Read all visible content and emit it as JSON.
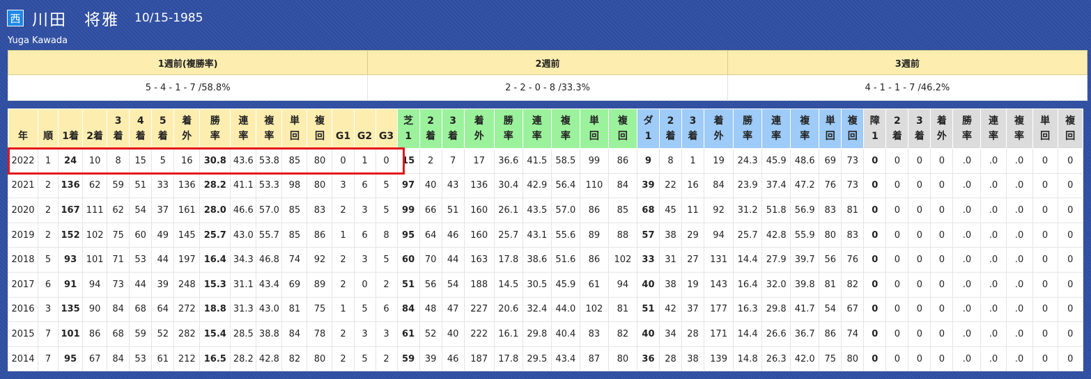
{
  "header": {
    "region_badge": "西",
    "name": "川田　将雅",
    "birthdate": "10/15-1985",
    "romaji": "Yuga Kawada"
  },
  "weeks": [
    {
      "label": "1週前(複勝率)",
      "value": "5 - 4 - 1 - 7 /58.8%"
    },
    {
      "label": "2週前",
      "value": "2 - 2 - 0 - 8 /33.3%"
    },
    {
      "label": "3週前",
      "value": "4 - 1 - 1 - 7 /46.2%"
    }
  ],
  "columns": [
    {
      "l1": "",
      "l2": "年",
      "g": "y"
    },
    {
      "l1": "",
      "l2": "順",
      "g": "y"
    },
    {
      "l1": "",
      "l2": "1着",
      "g": "y"
    },
    {
      "l1": "",
      "l2": "2着",
      "g": "y"
    },
    {
      "l1": "3",
      "l2": "着",
      "g": "y"
    },
    {
      "l1": "4",
      "l2": "着",
      "g": "y"
    },
    {
      "l1": "5",
      "l2": "着",
      "g": "y"
    },
    {
      "l1": "着",
      "l2": "外",
      "g": "y"
    },
    {
      "l1": "勝",
      "l2": "率",
      "g": "y"
    },
    {
      "l1": "連",
      "l2": "率",
      "g": "y"
    },
    {
      "l1": "複",
      "l2": "率",
      "g": "y"
    },
    {
      "l1": "単",
      "l2": "回",
      "g": "y"
    },
    {
      "l1": "複",
      "l2": "回",
      "g": "y"
    },
    {
      "l1": "",
      "l2": "G1",
      "g": "y"
    },
    {
      "l1": "",
      "l2": "G2",
      "g": "y"
    },
    {
      "l1": "",
      "l2": "G3",
      "g": "y"
    },
    {
      "l1": "芝",
      "l2": "1",
      "g": "g"
    },
    {
      "l1": "2",
      "l2": "着",
      "g": "g"
    },
    {
      "l1": "3",
      "l2": "着",
      "g": "g"
    },
    {
      "l1": "着",
      "l2": "外",
      "g": "g"
    },
    {
      "l1": "勝",
      "l2": "率",
      "g": "g"
    },
    {
      "l1": "連",
      "l2": "率",
      "g": "g"
    },
    {
      "l1": "複",
      "l2": "率",
      "g": "g"
    },
    {
      "l1": "単",
      "l2": "回",
      "g": "g"
    },
    {
      "l1": "複",
      "l2": "回",
      "g": "g"
    },
    {
      "l1": "ダ",
      "l2": "1",
      "g": "b"
    },
    {
      "l1": "2",
      "l2": "着",
      "g": "b"
    },
    {
      "l1": "3",
      "l2": "着",
      "g": "b"
    },
    {
      "l1": "着",
      "l2": "外",
      "g": "b"
    },
    {
      "l1": "勝",
      "l2": "率",
      "g": "b"
    },
    {
      "l1": "連",
      "l2": "率",
      "g": "b"
    },
    {
      "l1": "複",
      "l2": "率",
      "g": "b"
    },
    {
      "l1": "単",
      "l2": "回",
      "g": "b"
    },
    {
      "l1": "複",
      "l2": "回",
      "g": "b"
    },
    {
      "l1": "障",
      "l2": "1",
      "g": "s"
    },
    {
      "l1": "2",
      "l2": "着",
      "g": "s"
    },
    {
      "l1": "3",
      "l2": "着",
      "g": "s"
    },
    {
      "l1": "着",
      "l2": "外",
      "g": "s"
    },
    {
      "l1": "勝",
      "l2": "率",
      "g": "s"
    },
    {
      "l1": "連",
      "l2": "率",
      "g": "s"
    },
    {
      "l1": "複",
      "l2": "率",
      "g": "s"
    },
    {
      "l1": "単",
      "l2": "回",
      "g": "s"
    },
    {
      "l1": "複",
      "l2": "回",
      "g": "s"
    }
  ],
  "rows": [
    [
      "2022",
      "1",
      "24",
      "10",
      "8",
      "15",
      "5",
      "16",
      "30.8",
      "43.6",
      "53.8",
      "85",
      "80",
      "0",
      "1",
      "0",
      "15",
      "2",
      "7",
      "17",
      "36.6",
      "41.5",
      "58.5",
      "99",
      "86",
      "9",
      "8",
      "1",
      "19",
      "24.3",
      "45.9",
      "48.6",
      "69",
      "73",
      "0",
      "0",
      "0",
      "0",
      ".0",
      ".0",
      ".0",
      "0",
      "0"
    ],
    [
      "2021",
      "2",
      "136",
      "62",
      "59",
      "51",
      "33",
      "136",
      "28.2",
      "41.1",
      "53.3",
      "98",
      "80",
      "3",
      "6",
      "5",
      "97",
      "40",
      "43",
      "136",
      "30.4",
      "42.9",
      "56.4",
      "110",
      "84",
      "39",
      "22",
      "16",
      "84",
      "23.9",
      "37.4",
      "47.2",
      "76",
      "73",
      "0",
      "0",
      "0",
      "0",
      ".0",
      ".0",
      ".0",
      "0",
      "0"
    ],
    [
      "2020",
      "2",
      "167",
      "111",
      "62",
      "54",
      "37",
      "161",
      "28.0",
      "46.6",
      "57.0",
      "85",
      "83",
      "2",
      "3",
      "5",
      "99",
      "66",
      "51",
      "160",
      "26.1",
      "43.5",
      "57.0",
      "86",
      "85",
      "68",
      "45",
      "11",
      "92",
      "31.2",
      "51.8",
      "56.9",
      "83",
      "81",
      "0",
      "0",
      "0",
      "0",
      ".0",
      ".0",
      ".0",
      "0",
      "0"
    ],
    [
      "2019",
      "2",
      "152",
      "102",
      "75",
      "60",
      "49",
      "145",
      "25.7",
      "43.0",
      "55.7",
      "85",
      "86",
      "1",
      "6",
      "8",
      "95",
      "64",
      "46",
      "160",
      "25.7",
      "43.1",
      "55.6",
      "89",
      "88",
      "57",
      "38",
      "29",
      "94",
      "25.7",
      "42.8",
      "55.9",
      "80",
      "83",
      "0",
      "0",
      "0",
      "0",
      ".0",
      ".0",
      ".0",
      "0",
      "0"
    ],
    [
      "2018",
      "5",
      "93",
      "101",
      "71",
      "53",
      "44",
      "197",
      "16.4",
      "34.3",
      "46.8",
      "74",
      "92",
      "2",
      "3",
      "5",
      "60",
      "70",
      "44",
      "163",
      "17.8",
      "38.6",
      "51.6",
      "86",
      "102",
      "33",
      "31",
      "27",
      "131",
      "14.4",
      "27.9",
      "39.7",
      "56",
      "76",
      "0",
      "0",
      "0",
      "0",
      ".0",
      ".0",
      ".0",
      "0",
      "0"
    ],
    [
      "2017",
      "6",
      "91",
      "94",
      "73",
      "44",
      "39",
      "248",
      "15.3",
      "31.1",
      "43.4",
      "69",
      "89",
      "2",
      "0",
      "2",
      "51",
      "56",
      "54",
      "188",
      "14.5",
      "30.5",
      "45.9",
      "61",
      "94",
      "40",
      "38",
      "19",
      "143",
      "16.4",
      "32.0",
      "39.8",
      "81",
      "82",
      "0",
      "0",
      "0",
      "0",
      ".0",
      ".0",
      ".0",
      "0",
      "0"
    ],
    [
      "2016",
      "3",
      "135",
      "90",
      "84",
      "68",
      "64",
      "272",
      "18.8",
      "31.3",
      "43.0",
      "81",
      "75",
      "1",
      "5",
      "6",
      "84",
      "48",
      "47",
      "227",
      "20.6",
      "32.4",
      "44.0",
      "102",
      "81",
      "51",
      "42",
      "37",
      "177",
      "16.3",
      "29.8",
      "41.7",
      "54",
      "67",
      "0",
      "0",
      "0",
      "0",
      ".0",
      ".0",
      ".0",
      "0",
      "0"
    ],
    [
      "2015",
      "7",
      "101",
      "86",
      "68",
      "59",
      "52",
      "282",
      "15.4",
      "28.5",
      "38.8",
      "84",
      "78",
      "2",
      "3",
      "3",
      "61",
      "52",
      "40",
      "222",
      "16.1",
      "29.8",
      "40.4",
      "83",
      "82",
      "40",
      "34",
      "28",
      "171",
      "14.4",
      "26.6",
      "36.7",
      "86",
      "74",
      "0",
      "0",
      "0",
      "0",
      ".0",
      ".0",
      ".0",
      "0",
      "0"
    ],
    [
      "2014",
      "7",
      "95",
      "67",
      "84",
      "53",
      "61",
      "212",
      "16.5",
      "28.2",
      "42.8",
      "82",
      "80",
      "2",
      "5",
      "2",
      "59",
      "39",
      "46",
      "187",
      "17.8",
      "29.5",
      "43.4",
      "87",
      "80",
      "36",
      "28",
      "38",
      "139",
      "14.8",
      "26.3",
      "42.0",
      "75",
      "80",
      "0",
      "0",
      "0",
      "0",
      ".0",
      ".0",
      ".0",
      "0",
      "0"
    ]
  ],
  "bold_columns": [
    2,
    8,
    16,
    25,
    34
  ],
  "colors": {
    "highlight_border": "#e4161b",
    "background": "#2f4fa3"
  }
}
